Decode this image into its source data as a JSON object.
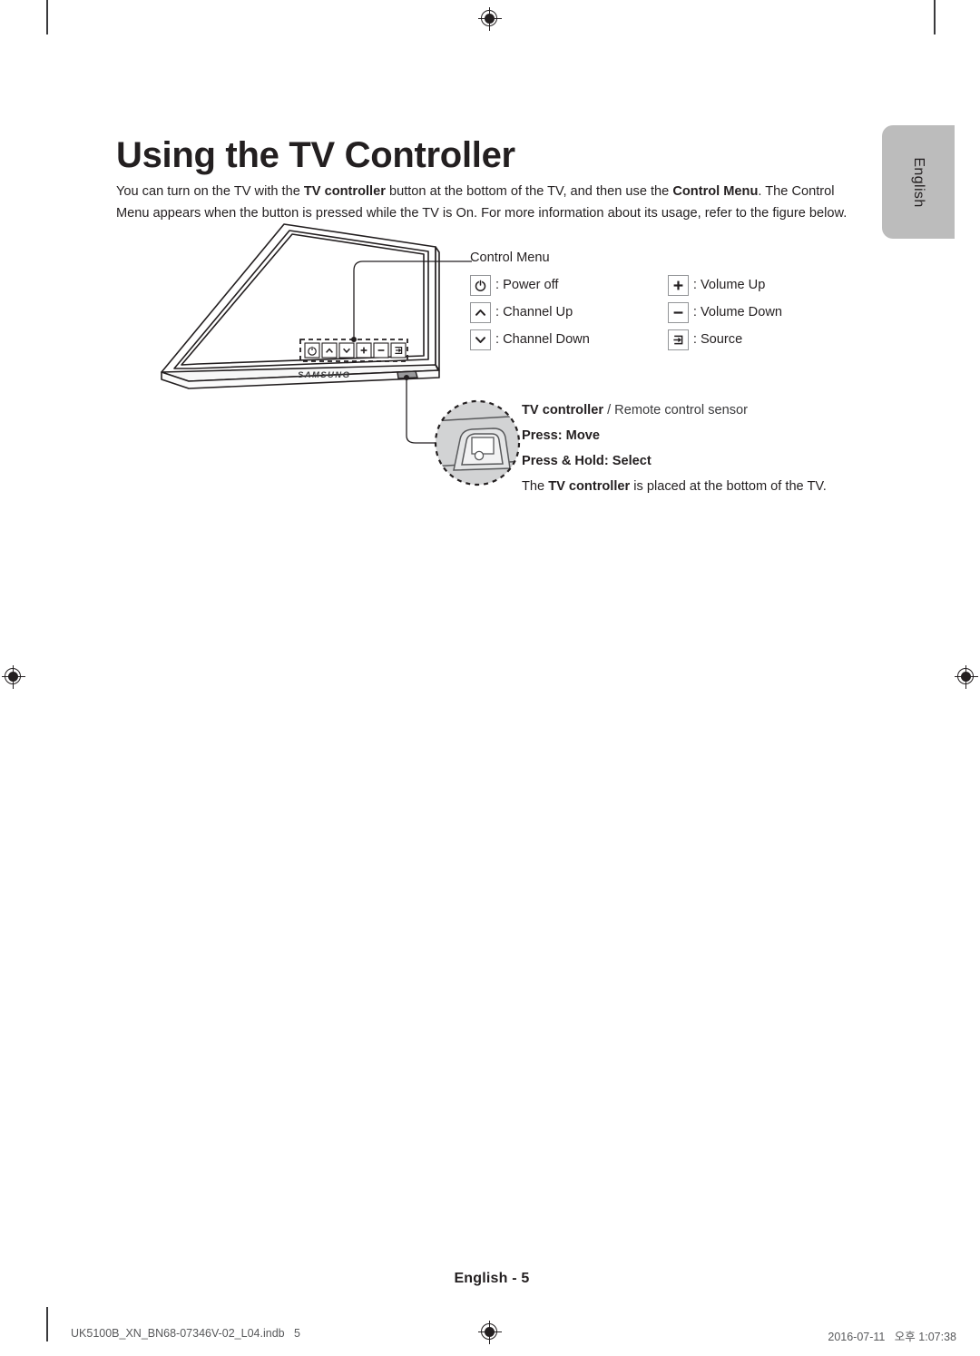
{
  "document": {
    "title": "Using the TV Controller",
    "intro_parts": [
      {
        "text": "You can turn on the TV with the ",
        "bold": false
      },
      {
        "text": "TV controller",
        "bold": true
      },
      {
        "text": " button at the bottom of the TV, and then use the ",
        "bold": false
      },
      {
        "text": "Control Menu",
        "bold": true
      },
      {
        "text": ". The Control Menu appears when the button is pressed while the TV is On. For more information about its usage, refer to the figure below.",
        "bold": false
      }
    ],
    "language_tab": "English",
    "footer_page": "English - 5",
    "printmark_left": "UK5100B_XN_BN68-07346V-02_L04.indb   5",
    "printmark_right": "2016-07-11   오후 1:07:38"
  },
  "figure": {
    "brand_logo": "SAMSUNG",
    "tv_panel_buttons": [
      {
        "icon": "power-icon",
        "name": "power"
      },
      {
        "icon": "chevron-up-icon",
        "name": "channel-up"
      },
      {
        "icon": "chevron-down-icon",
        "name": "channel-down"
      },
      {
        "icon": "plus-icon",
        "name": "volume-up"
      },
      {
        "icon": "minus-icon",
        "name": "volume-down"
      },
      {
        "icon": "source-icon",
        "name": "source"
      }
    ]
  },
  "legend": {
    "title": "Control Menu",
    "left_column": [
      {
        "icon": "power-icon",
        "label": ": Power off"
      },
      {
        "icon": "chevron-up-icon",
        "label": ": Channel Up"
      },
      {
        "icon": "chevron-down-icon",
        "label": ": Channel Down"
      }
    ],
    "right_column": [
      {
        "icon": "plus-icon",
        "label": ": Volume Up"
      },
      {
        "icon": "minus-icon",
        "label": ": Volume Down"
      },
      {
        "icon": "source-icon",
        "label": ": Source"
      }
    ]
  },
  "callout": {
    "heading_bold": "TV controller",
    "heading_rest": " / Remote control sensor",
    "line_move": "Press: Move",
    "line_select": "Press & Hold: Select",
    "note_prefix": "The ",
    "note_bold": "TV controller",
    "note_suffix": " is placed at the bottom of the TV."
  },
  "colors": {
    "ink": "#231f20",
    "tab_gray": "#bcbcbc",
    "icon_border": "#939598",
    "line": "#58595b"
  }
}
